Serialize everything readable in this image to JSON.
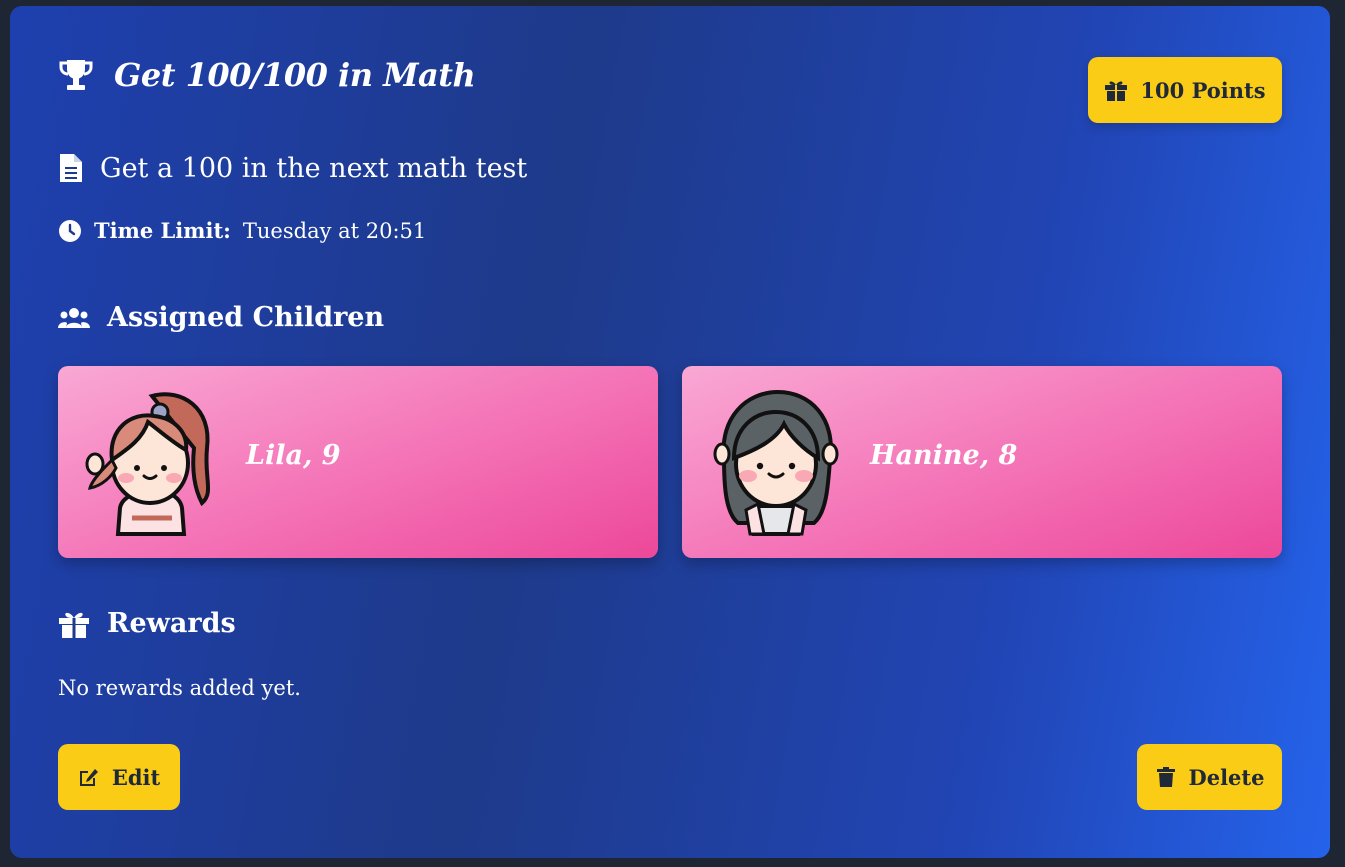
{
  "task": {
    "title": "Get 100/100 in Math",
    "points_label": "100 Points",
    "description": "Get a 100 in the next math test",
    "time_limit_label": "Time Limit:",
    "time_limit_value": "Tuesday at 20:51"
  },
  "assigned": {
    "heading": "Assigned Children",
    "children": [
      {
        "name": "Lila, 9",
        "avatar_icon": "girl-ponytail-avatar"
      },
      {
        "name": "Hanine, 8",
        "avatar_icon": "girl-dark-hair-avatar"
      }
    ]
  },
  "rewards": {
    "heading": "Rewards",
    "empty_text": "No rewards added yet."
  },
  "actions": {
    "edit_label": "Edit",
    "delete_label": "Delete"
  },
  "colors": {
    "accent": "#facc15",
    "card_start": "#1e40af",
    "card_end": "#2563eb",
    "child_card": "#f472b6"
  }
}
